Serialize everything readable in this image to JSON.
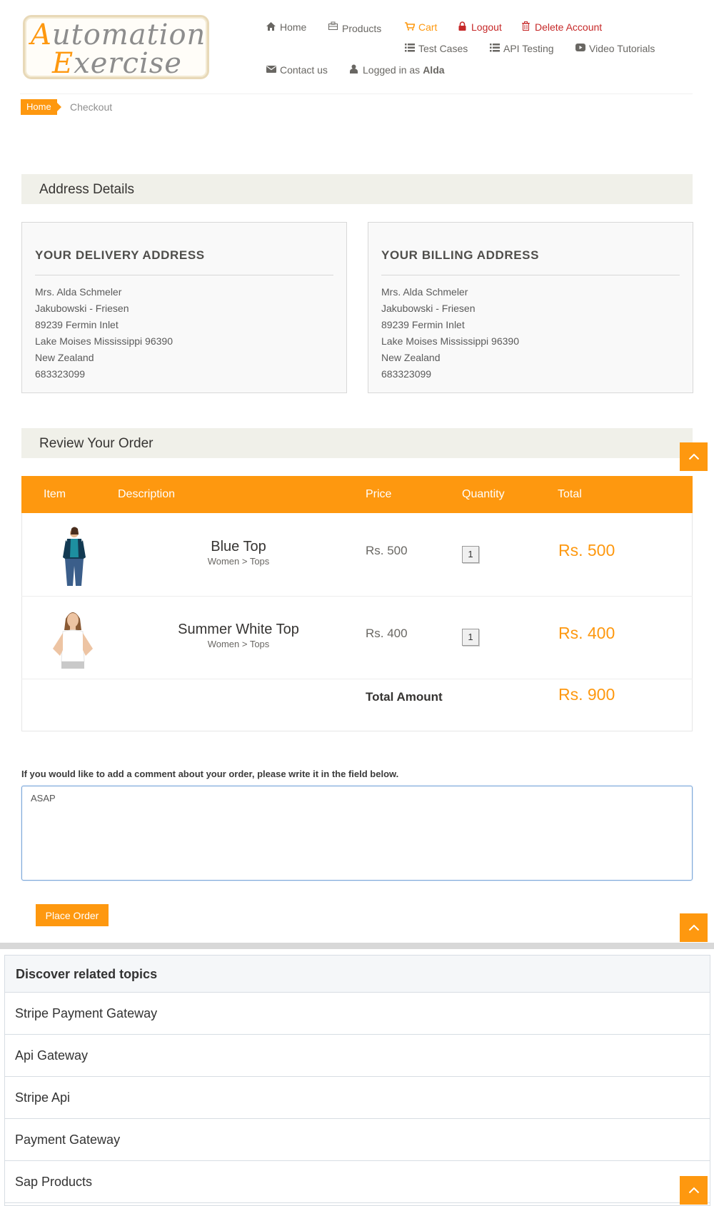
{
  "logo": {
    "line1_cap": "A",
    "line1_rest": "utomation",
    "line2_cap": "E",
    "line2_rest": "xercise"
  },
  "nav": {
    "home": {
      "label": "Home",
      "icon": "home-icon"
    },
    "products": {
      "label": "Products",
      "icon": "products-icon"
    },
    "cart": {
      "label": "Cart",
      "icon": "cart-icon"
    },
    "logout": {
      "label": "Logout",
      "icon": "lock-icon"
    },
    "delete_account": {
      "label": "Delete Account",
      "icon": "trash-icon"
    },
    "test_cases": {
      "label": "Test Cases",
      "icon": "list-icon"
    },
    "api_testing": {
      "label": "API Testing",
      "icon": "list-icon"
    },
    "video_tutorials": {
      "label": "Video Tutorials",
      "icon": "youtube-icon"
    },
    "contact": {
      "label": "Contact us",
      "icon": "envelope-icon"
    },
    "logged_in_prefix": "Logged in as",
    "logged_in_user": "Alda"
  },
  "breadcrumb": {
    "home": "Home",
    "current": "Checkout"
  },
  "address_section": {
    "title": "Address Details",
    "delivery": {
      "heading": "YOUR DELIVERY ADDRESS",
      "lines": [
        "Mrs. Alda Schmeler",
        "Jakubowski - Friesen",
        "89239 Fermin Inlet",
        "Lake Moises Mississippi 96390",
        "New Zealand",
        "683323099"
      ]
    },
    "billing": {
      "heading": "YOUR BILLING ADDRESS",
      "lines": [
        "Mrs. Alda Schmeler",
        "Jakubowski - Friesen",
        "89239 Fermin Inlet",
        "Lake Moises Mississippi 96390",
        "New Zealand",
        "683323099"
      ]
    }
  },
  "review": {
    "title": "Review Your Order",
    "columns": [
      "Item",
      "Description",
      "Price",
      "Quantity",
      "Total"
    ],
    "items": [
      {
        "name": "Blue Top",
        "category": "Women > Tops",
        "price": "Rs. 500",
        "quantity": "1",
        "total": "Rs. 500"
      },
      {
        "name": "Summer White Top",
        "category": "Women > Tops",
        "price": "Rs. 400",
        "quantity": "1",
        "total": "Rs. 400"
      }
    ],
    "total_label": "Total Amount",
    "total_value": "Rs. 900"
  },
  "comment": {
    "label": "If you would like to add a comment about your order, please write it in the field below.",
    "value": "ASAP"
  },
  "place_order": "Place Order",
  "related": {
    "title": "Discover related topics",
    "items": [
      "Stripe Payment Gateway",
      "Api Gateway",
      "Stripe Api",
      "Payment Gateway",
      "Sap Products"
    ]
  },
  "colors": {
    "accent": "#FE980F",
    "section_bg": "#F0F0E9",
    "danger": "#c62828"
  }
}
